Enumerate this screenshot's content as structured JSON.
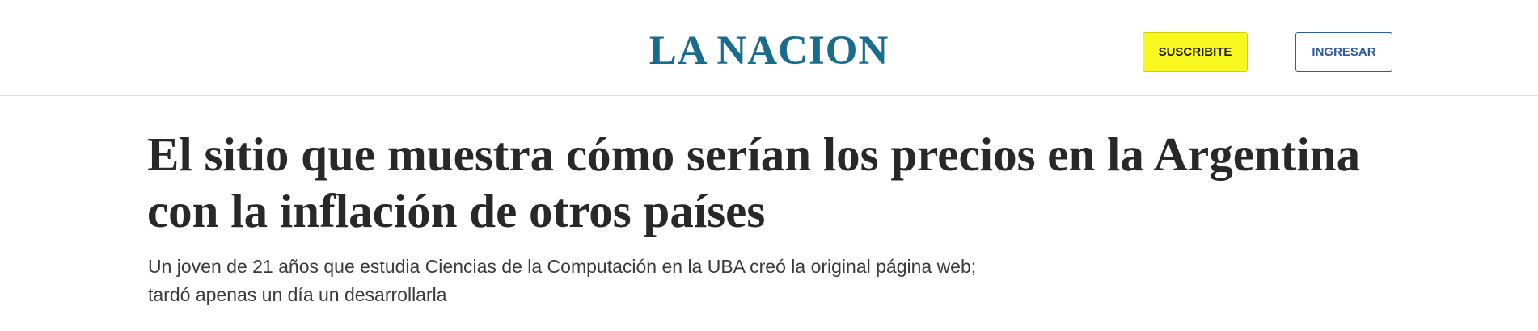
{
  "header": {
    "logo_text": "LA NACION",
    "subscribe_label": "SUSCRIBITE",
    "login_label": "INGRESAR"
  },
  "article": {
    "headline": "El sitio que muestra cómo serían los precios en la Argentina con la inflación de otros países",
    "subheadline": "Un joven de 21 años que estudia Ciencias de la Computación en la UBA creó la original página web; tardó apenas un día un desarrollarla"
  },
  "colors": {
    "brand": "#1a6c8e",
    "subscribe_bg": "#f9f91f",
    "login_accent": "#2e5a9e",
    "headline_text": "#282828"
  }
}
